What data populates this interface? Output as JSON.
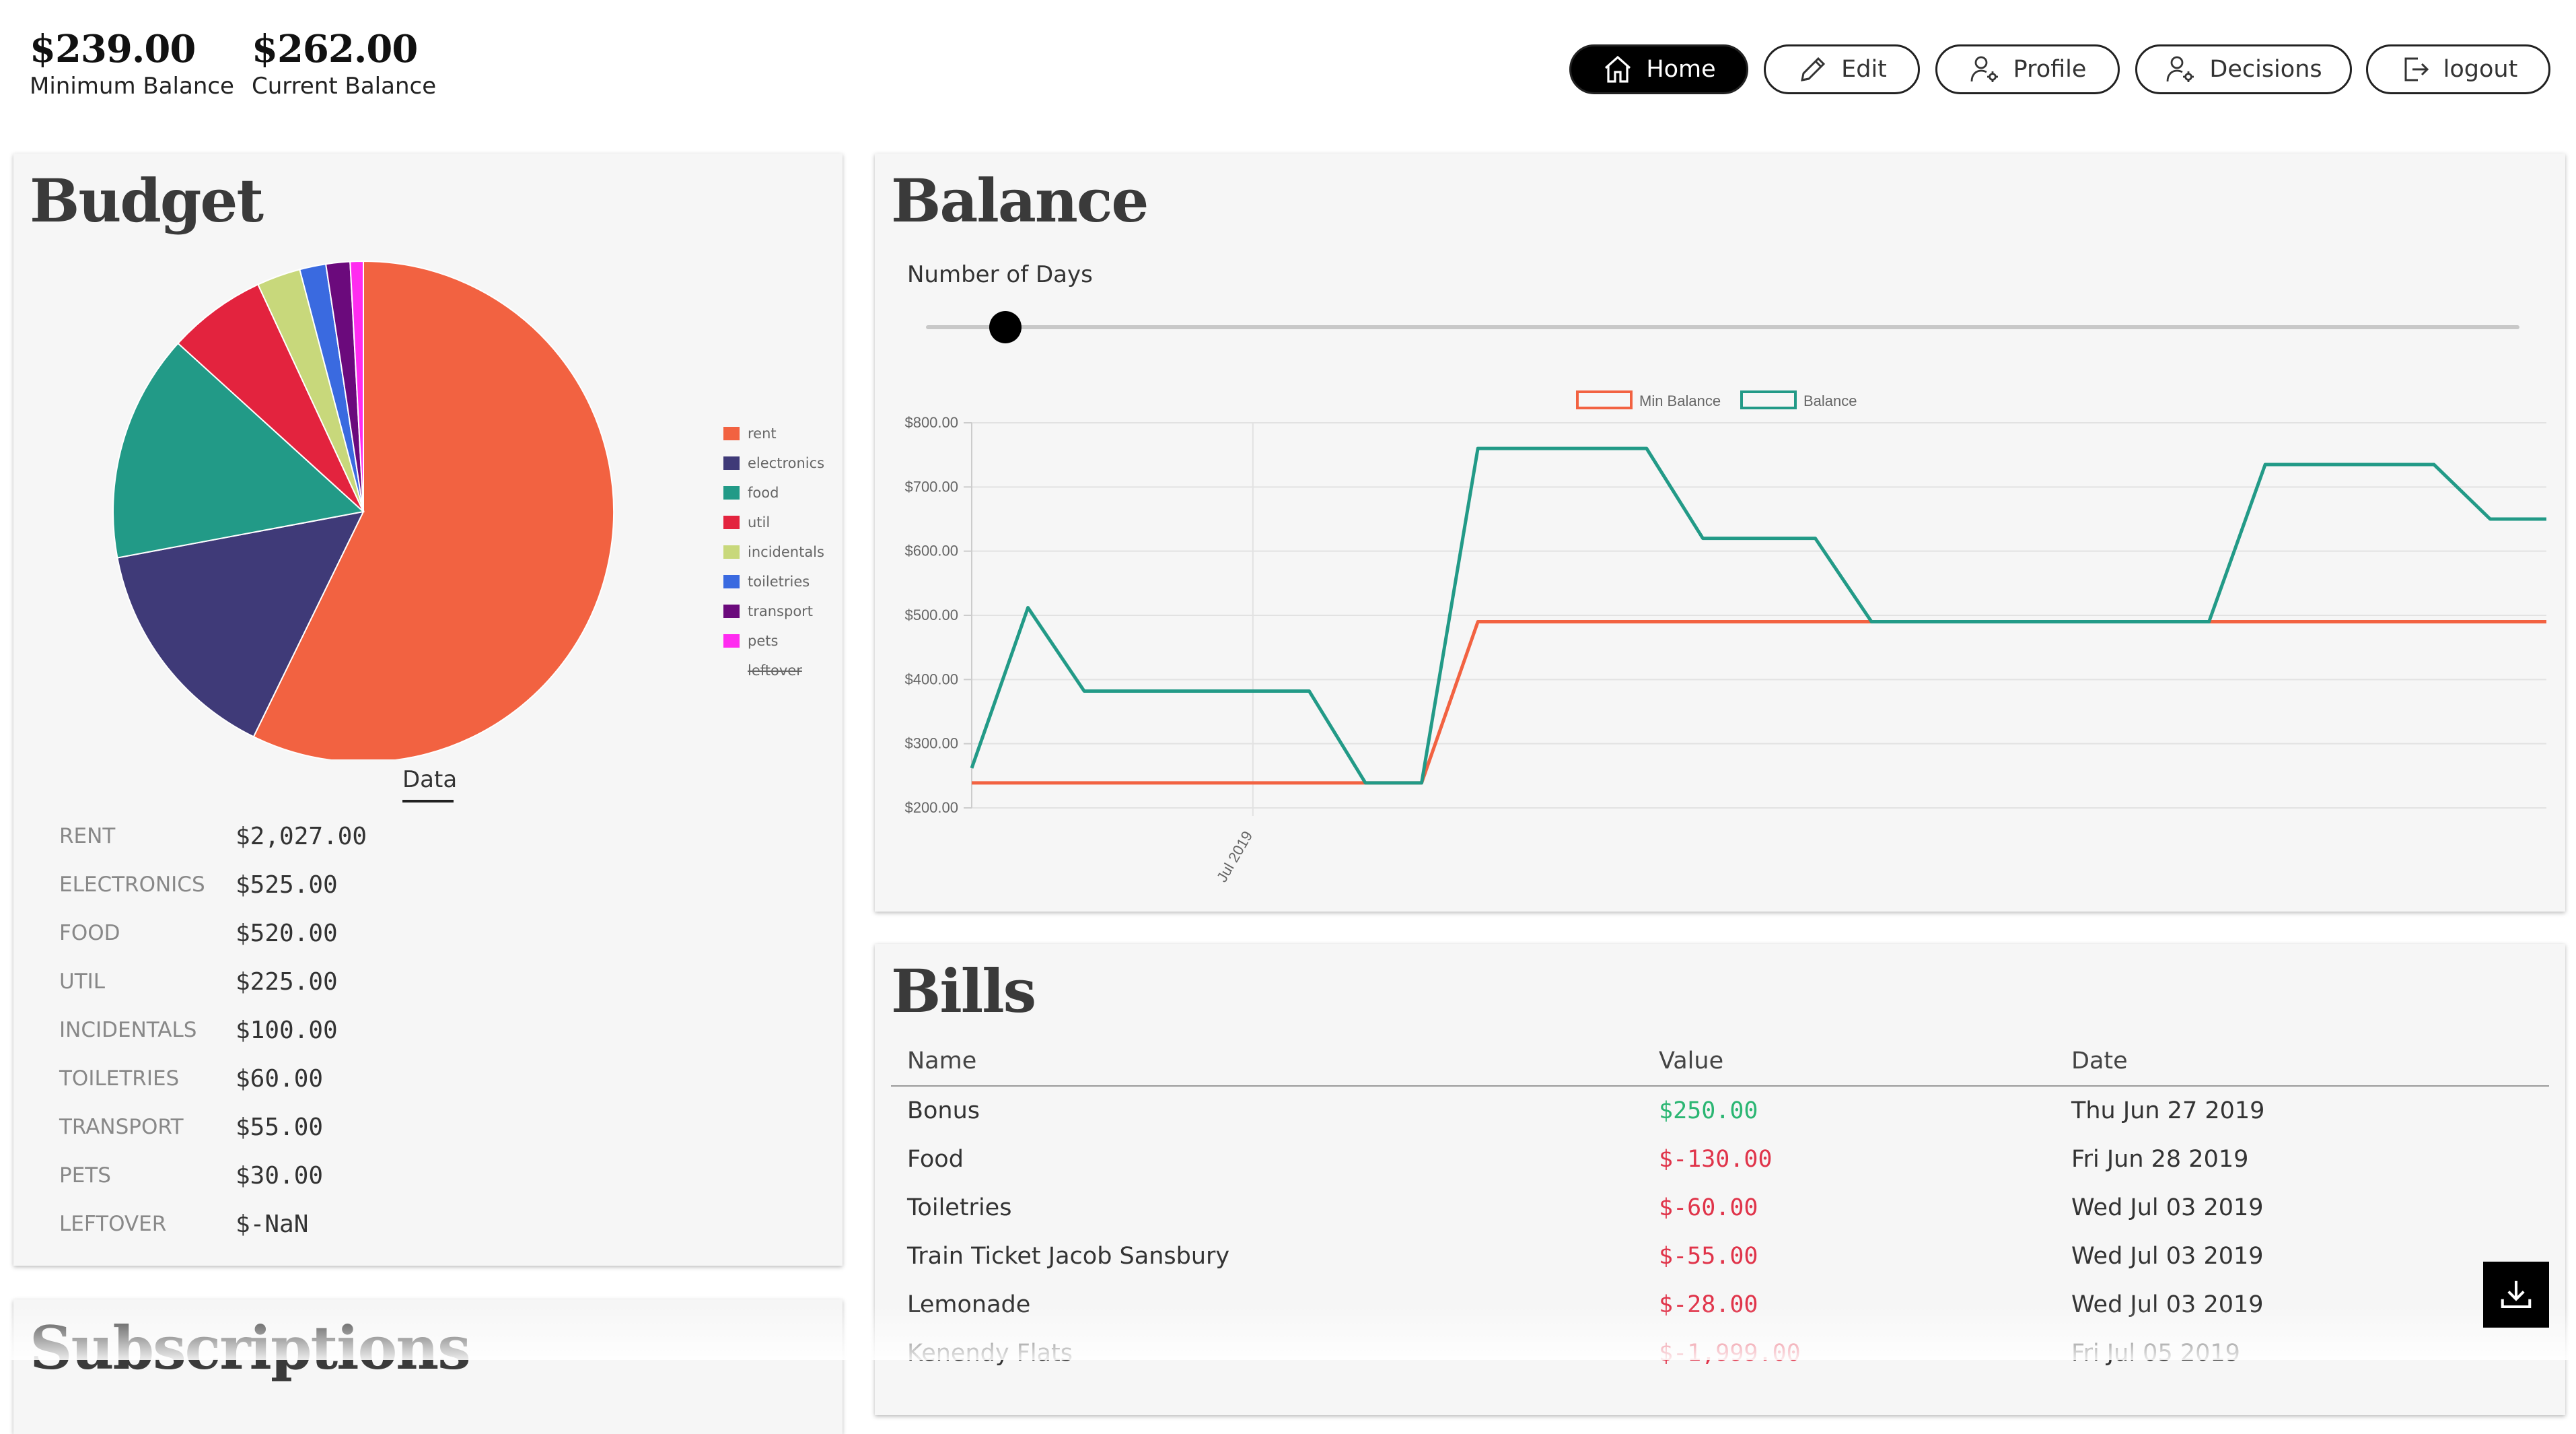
{
  "header": {
    "min_balance_value": "$239.00",
    "min_balance_label": "Minimum Balance",
    "current_balance_value": "$262.00",
    "current_balance_label": "Current Balance"
  },
  "nav": {
    "home": "Home",
    "edit": "Edit",
    "profile": "Profile",
    "decisions": "Decisions",
    "logout": "logout"
  },
  "budget": {
    "title": "Budget",
    "tab_label": "Data",
    "items": [
      {
        "name": "RENT",
        "value": "$2,027.00"
      },
      {
        "name": "ELECTRONICS",
        "value": "$525.00"
      },
      {
        "name": "FOOD",
        "value": "$520.00"
      },
      {
        "name": "UTIL",
        "value": "$225.00"
      },
      {
        "name": "INCIDENTALS",
        "value": "$100.00"
      },
      {
        "name": "TOILETRIES",
        "value": "$60.00"
      },
      {
        "name": "TRANSPORT",
        "value": "$55.00"
      },
      {
        "name": "PETS",
        "value": "$30.00"
      },
      {
        "name": "LEFTOVER",
        "value": "$-NaN"
      }
    ]
  },
  "chart_data": [
    {
      "type": "pie",
      "title": "",
      "legend_position": "right",
      "slices": [
        {
          "label": "rent",
          "value": 2027,
          "color": "#f26241"
        },
        {
          "label": "electronics",
          "value": 525,
          "color": "#3f3a78"
        },
        {
          "label": "food",
          "value": 520,
          "color": "#229a87"
        },
        {
          "label": "util",
          "value": 225,
          "color": "#e3233e"
        },
        {
          "label": "incidentals",
          "value": 100,
          "color": "#c8d87b"
        },
        {
          "label": "toiletries",
          "value": 60,
          "color": "#3a6ae0"
        },
        {
          "label": "transport",
          "value": 55,
          "color": "#6b0a7c"
        },
        {
          "label": "pets",
          "value": 30,
          "color": "#ff2bf0"
        }
      ],
      "hidden_legend": [
        "leftover"
      ]
    },
    {
      "type": "line",
      "title": "",
      "legend_position": "top",
      "ylim": [
        200,
        800
      ],
      "y_ticks": [
        "$200.00",
        "$300.00",
        "$400.00",
        "$500.00",
        "$600.00",
        "$700.00",
        "$800.00"
      ],
      "x_tick_label": "Jul 2019",
      "grid": true,
      "series": [
        {
          "name": "Min Balance",
          "color": "#f26241",
          "values": [
            239,
            239,
            239,
            239,
            239,
            239,
            239,
            239,
            239,
            490,
            490,
            490,
            490,
            490,
            490,
            490,
            490,
            490,
            490,
            490,
            490,
            490,
            490,
            490,
            490,
            490,
            490,
            490,
            490
          ]
        },
        {
          "name": "Balance",
          "color": "#229a87",
          "values": [
            262,
            512,
            382,
            382,
            382,
            382,
            382,
            239,
            239,
            760,
            760,
            760,
            760,
            620,
            620,
            620,
            490,
            490,
            490,
            490,
            490,
            490,
            490,
            735,
            735,
            735,
            735,
            650,
            650
          ]
        }
      ]
    }
  ],
  "balance": {
    "title": "Balance",
    "slider_label": "Number of Days",
    "slider_value_fraction": 0.05,
    "legend_min": "Min Balance",
    "legend_balance": "Balance"
  },
  "bills": {
    "title": "Bills",
    "columns": [
      "Name",
      "Value",
      "Date"
    ],
    "rows": [
      {
        "name": "Bonus",
        "value": "$250.00",
        "date": "Thu Jun 27 2019",
        "positive": true
      },
      {
        "name": "Food",
        "value": "$-130.00",
        "date": "Fri Jun 28 2019",
        "positive": false
      },
      {
        "name": "Toiletries",
        "value": "$-60.00",
        "date": "Wed Jul 03 2019",
        "positive": false
      },
      {
        "name": "Train Ticket Jacob Sansbury",
        "value": "$-55.00",
        "date": "Wed Jul 03 2019",
        "positive": false
      },
      {
        "name": "Lemonade",
        "value": "$-28.00",
        "date": "Wed Jul 03 2019",
        "positive": false
      },
      {
        "name": "Kenendy Flats",
        "value": "$-1,999.00",
        "date": "Fri Jul 05 2019",
        "positive": false
      }
    ]
  },
  "subscriptions": {
    "title": "Subscriptions"
  }
}
